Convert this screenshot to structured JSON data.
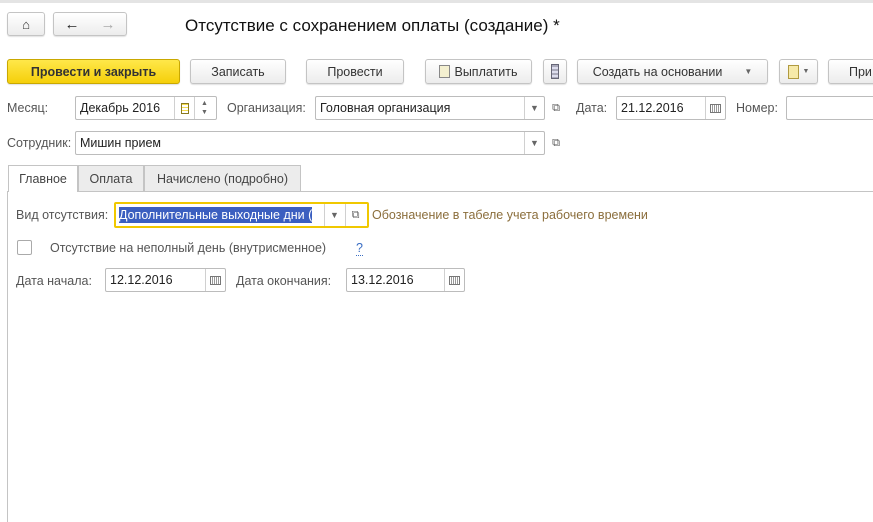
{
  "window": {
    "title": "Отсутствие с сохранением оплаты (создание) *"
  },
  "nav": {
    "home_icon": "home-icon",
    "back_icon": "arrow-left-icon",
    "forward_icon": "arrow-right-icon"
  },
  "toolbar": {
    "post_close": "Провести и закрыть",
    "save": "Записать",
    "post": "Провести",
    "pay": "Выплатить",
    "create_based": "Создать на основании",
    "more": "При"
  },
  "header": {
    "month_label": "Месяц:",
    "month_value": "Декабрь 2016",
    "org_label": "Организация:",
    "org_value": "Головная организация",
    "date_label": "Дата:",
    "date_value": "21.12.2016",
    "number_label": "Номер:",
    "number_value": "",
    "employee_label": "Сотрудник:",
    "employee_value": "Мишин прием"
  },
  "tabs": [
    {
      "label": "Главное",
      "active": true
    },
    {
      "label": "Оплата"
    },
    {
      "label": "Начислено (подробно)"
    }
  ],
  "main": {
    "absence_type_label": "Вид отсутствия:",
    "absence_type_value": "Дополнительные выходные дни (",
    "absence_hint": "Обозначение в табеле учета рабочего времени",
    "partial_day_label": "Отсутствие на неполный день (внутрисменное)",
    "partial_day_checked": false,
    "help": "?",
    "start_label": "Дата начала:",
    "start_value": "12.12.2016",
    "end_label": "Дата окончания:",
    "end_value": "13.12.2016"
  },
  "colors": {
    "accent": "#f5cf0a",
    "hint": "#8b6e3c",
    "selection": "#3b5fc0",
    "link": "#3a6ec4"
  }
}
